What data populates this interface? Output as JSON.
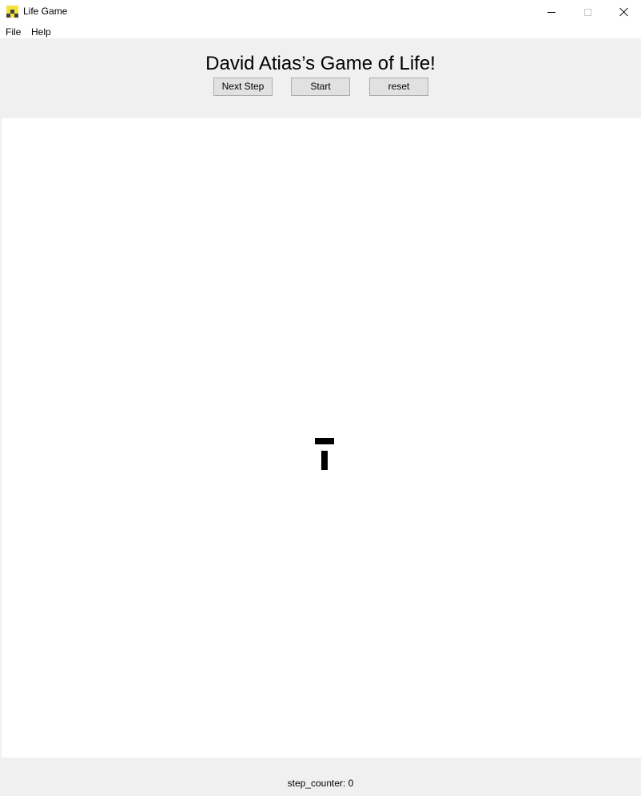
{
  "window": {
    "title": "Life Game",
    "icon": "life-game-checker-icon",
    "controls": {
      "minimize_icon": "minimize-icon",
      "maximize_icon": "maximize-icon",
      "close_icon": "close-icon"
    }
  },
  "menu": {
    "items": [
      {
        "label": "File"
      },
      {
        "label": "Help"
      }
    ]
  },
  "header": {
    "title": "David Atias’s Game of Life!",
    "buttons": {
      "next_step": "Next Step",
      "start": "Start",
      "reset": "reset"
    }
  },
  "grid": {
    "live_cell_color": "#000000",
    "background_color": "#ffffff",
    "live_cells_count_visible": 2
  },
  "footer": {
    "step_counter": "step_counter: 0"
  },
  "colors": {
    "panel_background": "#f0f0f0",
    "button_background": "#e1e1e1",
    "button_border": "#adadad"
  }
}
